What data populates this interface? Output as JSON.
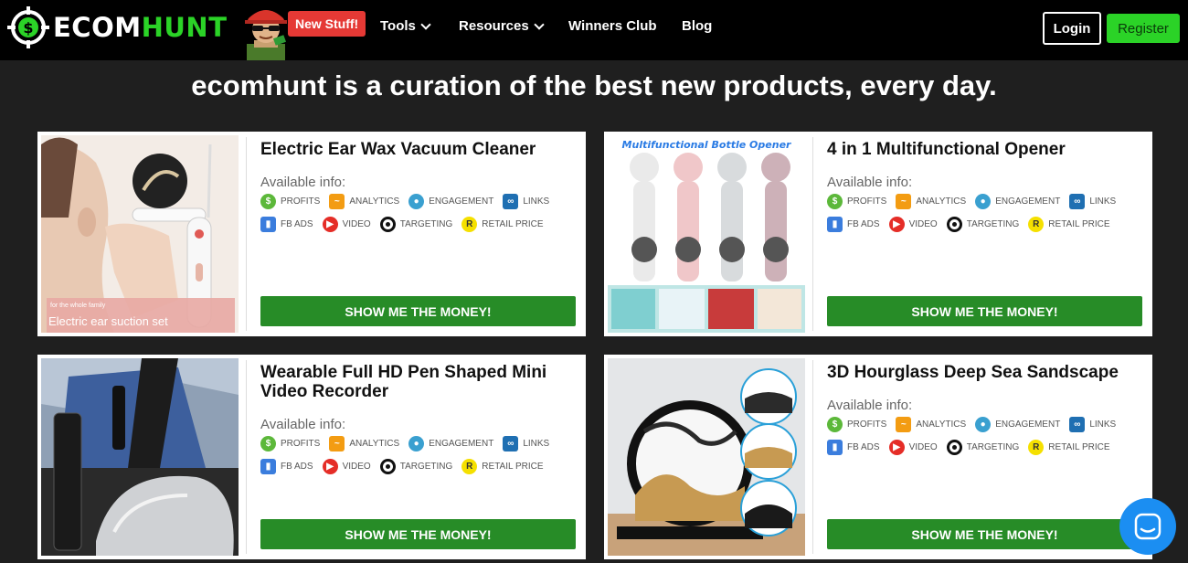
{
  "nav": {
    "logo_white": "ECOM",
    "logo_green": "HUNT",
    "new_badge": "New Stuff!",
    "menu": [
      {
        "label": "Tools",
        "dropdown": true
      },
      {
        "label": "Resources",
        "dropdown": true
      },
      {
        "label": "Winners Club",
        "dropdown": false
      },
      {
        "label": "Blog",
        "dropdown": false
      }
    ],
    "login": "Login",
    "register": "Register"
  },
  "tagline": "ecomhunt is a curation of the best new products, every day.",
  "info_labels": {
    "profits": "PROFITS",
    "analytics": "ANALYTICS",
    "engagement": "ENGAGEMENT",
    "links": "LINKS",
    "fb_ads": "FB ADS",
    "video": "VIDEO",
    "targeting": "TARGETING",
    "retail_price": "RETAIL PRICE"
  },
  "available_label": "Available info:",
  "cta": "SHOW ME THE MONEY!",
  "products": [
    {
      "title": "Electric Ear Wax Vacuum Cleaner",
      "image_caption": "Electric ear suction set",
      "image_tag": "for the whole family"
    },
    {
      "title": "4 in 1 Multifunctional Opener",
      "image_caption": "Multifunctional Bottle Opener"
    },
    {
      "title": "Wearable Full HD Pen Shaped Mini Video Recorder"
    },
    {
      "title": "3D Hourglass Deep Sea Sandscape"
    }
  ],
  "colors": {
    "brand_green": "#2bd327",
    "cta_green": "#278c27",
    "badge_red": "#e53935",
    "chat_blue": "#1b8ef2"
  }
}
